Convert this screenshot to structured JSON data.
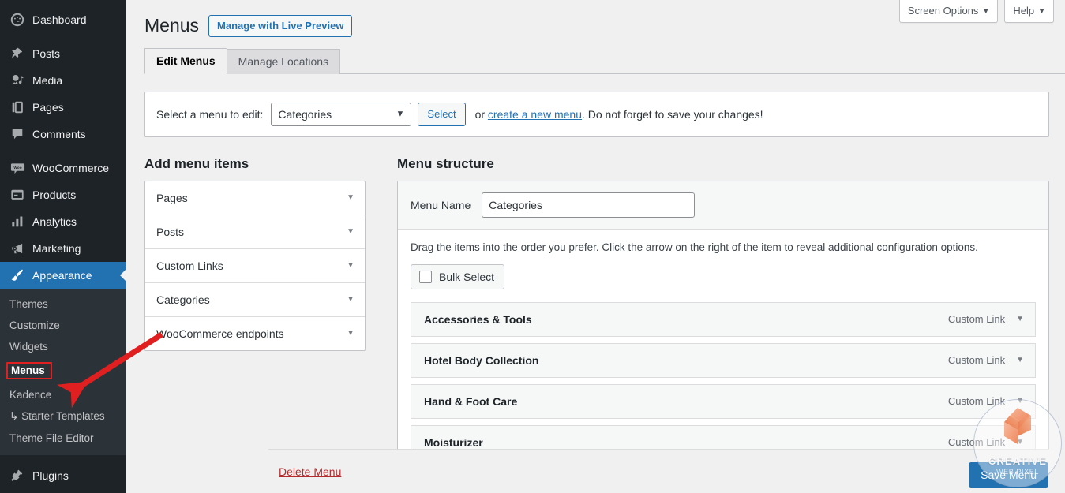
{
  "sidebar": {
    "items": [
      {
        "label": "Dashboard",
        "icon": "dashboard-icon"
      },
      {
        "label": "Posts",
        "icon": "pin-icon"
      },
      {
        "label": "Media",
        "icon": "media-icon"
      },
      {
        "label": "Pages",
        "icon": "pages-icon"
      },
      {
        "label": "Comments",
        "icon": "comments-icon"
      },
      {
        "label": "WooCommerce",
        "icon": "woocommerce-icon"
      },
      {
        "label": "Products",
        "icon": "products-icon"
      },
      {
        "label": "Analytics",
        "icon": "analytics-icon"
      },
      {
        "label": "Marketing",
        "icon": "megaphone-icon"
      },
      {
        "label": "Appearance",
        "icon": "brush-icon"
      },
      {
        "label": "Plugins",
        "icon": "plugin-icon"
      }
    ],
    "appearance_submenu": [
      {
        "label": "Themes"
      },
      {
        "label": "Customize"
      },
      {
        "label": "Widgets"
      },
      {
        "label": "Menus"
      },
      {
        "label": "Kadence"
      },
      {
        "label": "Starter Templates"
      },
      {
        "label": "Theme File Editor"
      }
    ],
    "current_submenu": "Menus",
    "active_item": "Appearance",
    "sidebar_bg": "#1d2327",
    "submenu_bg": "#2c3338",
    "active_bg": "#2271b1"
  },
  "header": {
    "screen_options": "Screen Options",
    "help": "Help",
    "caret": "▼"
  },
  "page": {
    "title": "Menus",
    "live_preview_button": "Manage with Live Preview"
  },
  "tabs": [
    {
      "label": "Edit Menus",
      "active": true
    },
    {
      "label": "Manage Locations",
      "active": false
    }
  ],
  "select_bar": {
    "label": "Select a menu to edit:",
    "selected_menu": "Categories",
    "options": [
      "Categories"
    ],
    "select_button": "Select",
    "tail_prefix": "or ",
    "create_link": "create a new menu",
    "tail_suffix": ". Do not forget to save your changes!"
  },
  "add_menu_items": {
    "heading": "Add menu items",
    "panels": [
      {
        "label": "Pages"
      },
      {
        "label": "Posts"
      },
      {
        "label": "Custom Links"
      },
      {
        "label": "Categories"
      },
      {
        "label": "WooCommerce endpoints"
      }
    ],
    "arrow": "▼"
  },
  "menu_structure": {
    "heading": "Menu structure",
    "menu_name_label": "Menu Name",
    "menu_name_value": "Categories",
    "hint": "Drag the items into the order you prefer. Click the arrow on the right of the item to reveal additional configuration options.",
    "bulk_select": "Bulk Select",
    "items": [
      {
        "title": "Accessories & Tools",
        "type": "Custom Link"
      },
      {
        "title": "Hotel Body Collection",
        "type": "Custom Link"
      },
      {
        "title": "Hand & Foot Care",
        "type": "Custom Link"
      },
      {
        "title": "Moisturizer",
        "type": "Custom Link"
      }
    ],
    "item_caret": "▼"
  },
  "footer": {
    "delete_menu": "Delete Menu",
    "save_menu": "Save Menu"
  },
  "watermark": {
    "line1": "CREATIVE",
    "line2": "WEB PIXEL",
    "logo_color": "#ef7d4f"
  },
  "annotation": {
    "highlight_target": "Menus",
    "arrow_color": "#e02020"
  }
}
